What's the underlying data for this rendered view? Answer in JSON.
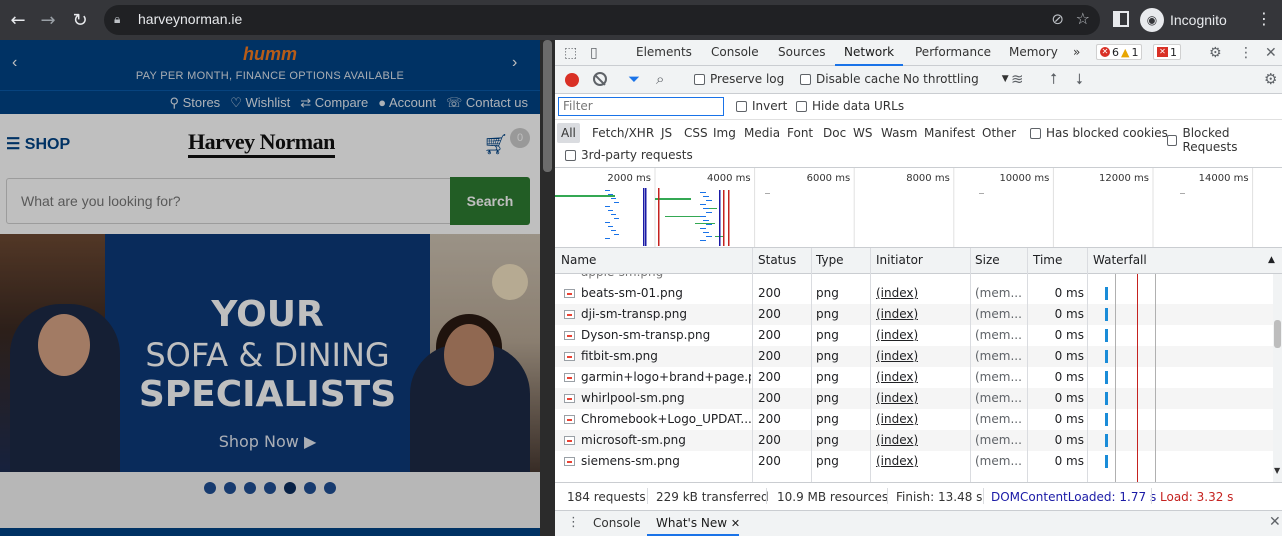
{
  "browser": {
    "url": "harveynorman.ie",
    "profile_label": "Incognito",
    "icons": {
      "back": "back-arrow-icon",
      "forward": "forward-arrow-icon",
      "reload": "reload-icon",
      "lock": "lock-icon",
      "star": "bookmark-star-icon"
    }
  },
  "site": {
    "promo": {
      "brand": "humm",
      "text": "PAY PER MONTH, FINANCE OPTIONS AVAILABLE"
    },
    "utility_links": [
      "Stores",
      "Wishlist",
      "Compare",
      "Account",
      "Contact us"
    ],
    "shop_label": "SHOP",
    "logo": "Harvey Norman",
    "cart_count": "0",
    "search": {
      "placeholder": "What are you looking for?",
      "button": "Search"
    },
    "banner": {
      "line1": "YOUR",
      "line2": "SOFA & DINING",
      "line3": "SPECIALISTS",
      "cta": "Shop Now ▶"
    },
    "carousel": {
      "dots": 7,
      "active_index": 4
    },
    "colors": {
      "brand_blue": "#004386",
      "search_green": "#2e7d32",
      "humm_orange": "#f47b20"
    }
  },
  "devtools": {
    "tabs": [
      "Elements",
      "Console",
      "Sources",
      "Network",
      "Performance",
      "Memory"
    ],
    "active_tab": "Network",
    "more_tabs": "»",
    "badges": {
      "errors": "6",
      "warnings": "1",
      "issues": "1"
    },
    "toolbar": {
      "preserve_log": "Preserve log",
      "disable_cache": "Disable cache",
      "throttling": "No throttling"
    },
    "filter": {
      "placeholder": "Filter",
      "invert": "Invert",
      "hide_data_urls": "Hide data URLs"
    },
    "types": [
      "All",
      "Fetch/XHR",
      "JS",
      "CSS",
      "Img",
      "Media",
      "Font",
      "Doc",
      "WS",
      "Wasm",
      "Manifest",
      "Other"
    ],
    "has_blocked_cookies": "Has blocked cookies",
    "blocked_requests": "Blocked Requests",
    "third_party": "3rd-party requests",
    "overview_ticks": [
      "2000 ms",
      "4000 ms",
      "6000 ms",
      "8000 ms",
      "10000 ms",
      "12000 ms",
      "14000 ms"
    ],
    "columns": [
      "Name",
      "Status",
      "Type",
      "Initiator",
      "Size",
      "Time",
      "Waterfall"
    ],
    "requests": [
      {
        "name": "beats-sm-01.png",
        "status": "200",
        "type": "png",
        "initiator": "(index)",
        "size": "(mem...",
        "time": "0 ms"
      },
      {
        "name": "dji-sm-transp.png",
        "status": "200",
        "type": "png",
        "initiator": "(index)",
        "size": "(mem...",
        "time": "0 ms"
      },
      {
        "name": "Dyson-sm-transp.png",
        "status": "200",
        "type": "png",
        "initiator": "(index)",
        "size": "(mem...",
        "time": "0 ms"
      },
      {
        "name": "fitbit-sm.png",
        "status": "200",
        "type": "png",
        "initiator": "(index)",
        "size": "(mem...",
        "time": "0 ms"
      },
      {
        "name": "garmin+logo+brand+page.png",
        "status": "200",
        "type": "png",
        "initiator": "(index)",
        "size": "(mem...",
        "time": "0 ms"
      },
      {
        "name": "whirlpool-sm.png",
        "status": "200",
        "type": "png",
        "initiator": "(index)",
        "size": "(mem...",
        "time": "0 ms"
      },
      {
        "name": "Chromebook+Logo_UPDAT...",
        "status": "200",
        "type": "png",
        "initiator": "(index)",
        "size": "(mem...",
        "time": "0 ms"
      },
      {
        "name": "microsoft-sm.png",
        "status": "200",
        "type": "png",
        "initiator": "(index)",
        "size": "(mem...",
        "time": "0 ms"
      },
      {
        "name": "siemens-sm.png",
        "status": "200",
        "type": "png",
        "initiator": "(index)",
        "size": "(mem...",
        "time": "0 ms"
      }
    ],
    "summary": {
      "requests": "184 requests",
      "transferred": "229 kB transferred",
      "resources": "10.9 MB resources",
      "finish": "Finish: 13.48 s",
      "dom_content_loaded": "DOMContentLoaded: 1.77 s",
      "load": "Load: 3.32 s"
    },
    "drawer_tabs": [
      "Console",
      "What's New"
    ],
    "active_drawer_tab": "What's New"
  }
}
